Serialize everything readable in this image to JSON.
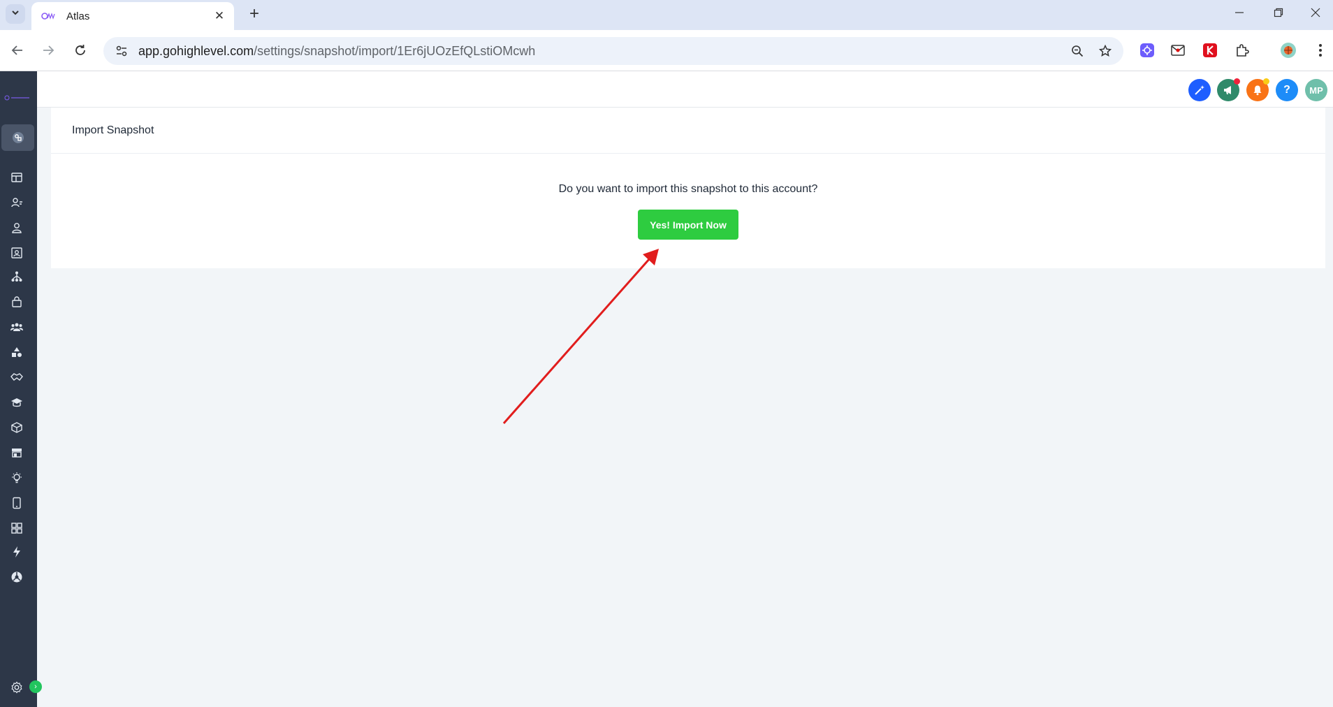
{
  "browser": {
    "tab_title": "Atlas",
    "url_host": "app.gohighlevel.com",
    "url_path": "/settings/snapshot/import/1Er6jUOzEfQLstiOMcwh"
  },
  "header": {
    "help_label": "?",
    "avatar_initials": "MP"
  },
  "page": {
    "title": "Import Snapshot",
    "question": "Do you want to import this snapshot to this account?",
    "import_button_label": "Yes! Import Now"
  },
  "colors": {
    "sidebar": "#2d3748",
    "import_button": "#2ecc40",
    "annotation_arrow": "#e11d1d"
  },
  "sidebar": {
    "icons": [
      "launchpad-icon",
      "dashboard-icon",
      "conversations-icon",
      "contacts-icon",
      "calendar-icon",
      "opportunities-icon",
      "payments-icon",
      "community-icon",
      "sites-icon",
      "reputation-icon",
      "memberships-icon",
      "media-icon",
      "marketplace-icon",
      "ideas-icon",
      "mobile-app-icon",
      "app-grid-icon",
      "automation-icon",
      "reporting-icon",
      "settings-icon"
    ]
  }
}
